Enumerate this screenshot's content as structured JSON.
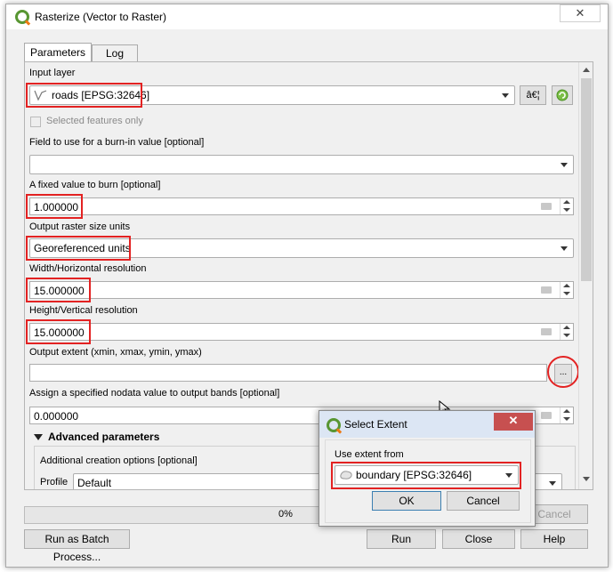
{
  "window": {
    "title": "Rasterize (Vector to Raster)",
    "close_glyph": "✕"
  },
  "tabs": [
    {
      "label": "Parameters"
    },
    {
      "label": "Log"
    }
  ],
  "input_layer": {
    "label": "Input layer",
    "value": "roads [EPSG:32646]",
    "selected_only_label": "Selected features only",
    "iterate_button_text": "â€¦"
  },
  "burn_field": {
    "label": "Field to use for a burn-in value [optional]",
    "value": ""
  },
  "fixed_burn": {
    "label": "A fixed value to burn [optional]",
    "value": "1.000000"
  },
  "raster_units": {
    "label": "Output raster size units",
    "value": "Georeferenced units"
  },
  "width_res": {
    "label": "Width/Horizontal resolution",
    "value": "15.000000"
  },
  "height_res": {
    "label": "Height/Vertical resolution",
    "value": "15.000000"
  },
  "extent": {
    "label": "Output extent (xmin, xmax, ymin, ymax)",
    "value": "",
    "button_text": "..."
  },
  "nodata": {
    "label": "Assign a specified nodata value to output bands [optional]",
    "value": "0.000000"
  },
  "advanced": {
    "label": "Advanced parameters",
    "creation_label": "Additional creation options [optional]",
    "profile_label": "Profile",
    "profile_value": "Default"
  },
  "progress": {
    "value": 0,
    "text": "0%"
  },
  "buttons": {
    "batch": "Run as Batch Process...",
    "cancel": "Cancel",
    "run": "Run",
    "close": "Close",
    "help": "Help"
  },
  "popup": {
    "title": "Select Extent",
    "close_glyph": "✕",
    "use_from_label": "Use extent from",
    "layer_value": "boundary [EPSG:32646]",
    "ok": "OK",
    "cancel": "Cancel"
  },
  "colors": {
    "highlight": "#e32222",
    "qgis_green": "#589632",
    "popup_title_bar": "#dce6f4",
    "popup_close": "#c75050"
  }
}
